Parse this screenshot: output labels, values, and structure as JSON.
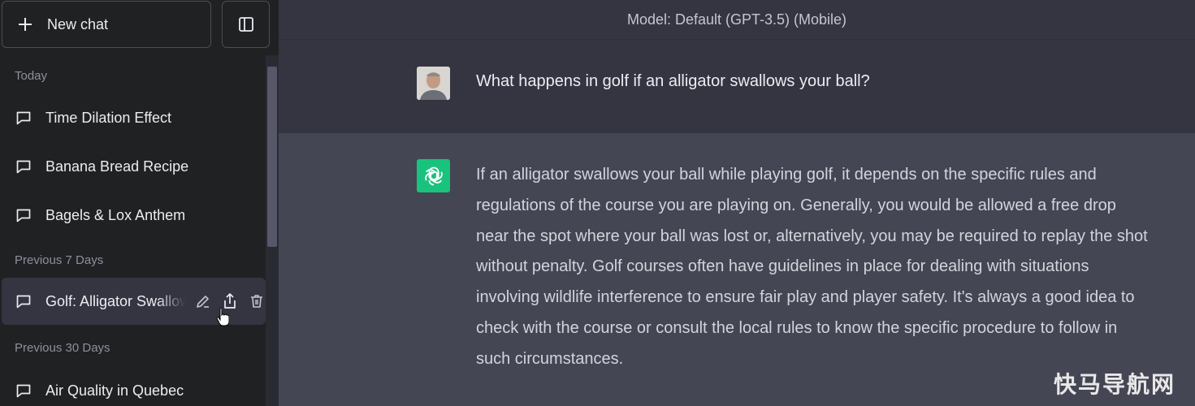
{
  "sidebar": {
    "new_chat_label": "New chat",
    "sections": [
      {
        "label": "Today"
      },
      {
        "label": "Previous 7 Days"
      },
      {
        "label": "Previous 30 Days"
      }
    ],
    "items": [
      {
        "label": "Time Dilation Effect"
      },
      {
        "label": "Banana Bread Recipe"
      },
      {
        "label": "Bagels & Lox Anthem"
      },
      {
        "label": "Golf: Alligator Swallows Ball"
      },
      {
        "label": "Air Quality in Quebec"
      }
    ],
    "active_item_actions": [
      "edit-icon",
      "share-icon",
      "trash-icon"
    ]
  },
  "header": {
    "model_label": "Model: Default (GPT-3.5) (Mobile)"
  },
  "conversation": {
    "user_message": "What happens in golf if an alligator swallows your ball?",
    "assistant_lines": [
      "If an alligator swallows your ball while playing golf, it depends on the specific rules and",
      "regulations of the course you are playing on. Generally, you would be allowed a free drop",
      "near the spot where your ball was lost or, alternatively, you may be required to replay the shot",
      "without penalty. Golf courses often have guidelines in place for dealing with situations",
      "involving wildlife interference to ensure fair play and player safety. It's always a good idea to",
      "check with the course or consult the local rules to know the specific procedure to follow in",
      "such circumstances."
    ]
  },
  "watermark": "快马导航网",
  "colors": {
    "sidebar_bg": "#202123",
    "main_bg": "#343541",
    "assistant_bg": "#444654",
    "bot_avatar": "#19c37d"
  }
}
